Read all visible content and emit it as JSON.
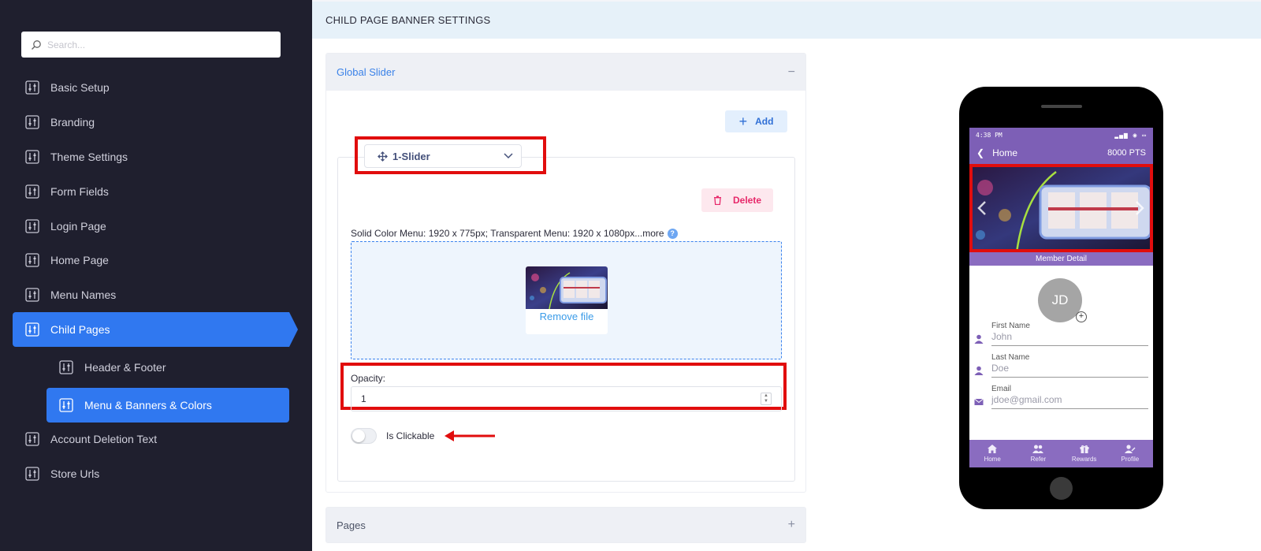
{
  "sidebar": {
    "search_placeholder": "Search...",
    "items": [
      {
        "label": "Basic Setup"
      },
      {
        "label": "Branding"
      },
      {
        "label": "Theme Settings"
      },
      {
        "label": "Form Fields"
      },
      {
        "label": "Login Page"
      },
      {
        "label": "Home Page"
      },
      {
        "label": "Menu Names"
      },
      {
        "label": "Child Pages"
      },
      {
        "label": "Header & Footer"
      },
      {
        "label": "Menu & Banners & Colors"
      },
      {
        "label": "Account Deletion Text"
      },
      {
        "label": "Store Urls"
      }
    ],
    "active_item": "Child Pages",
    "active_subitem": "Menu & Banners & Colors"
  },
  "main": {
    "page_title": "CHILD PAGE BANNER SETTINGS",
    "global_slider": {
      "title": "Global Slider",
      "collapse_symbol": "−",
      "add_label": "Add",
      "slider_name": "1-Slider",
      "delete_label": "Delete",
      "size_note": "Solid Color Menu: 1920 x 775px; Transparent Menu: 1920 x 1080px...more",
      "help_symbol": "?",
      "remove_file_label": "Remove file",
      "opacity_label": "Opacity:",
      "opacity_value": "1",
      "clickable_label": "Is Clickable",
      "clickable_on": false
    },
    "pages_panel": {
      "title": "Pages",
      "expand_symbol": "+"
    }
  },
  "phone": {
    "status_time": "4:38 PM",
    "header_title": "Home",
    "points": "8000 PTS",
    "member_detail": "Member Detail",
    "avatar_initials": "JD",
    "fields": [
      {
        "label": "First Name",
        "value": "John"
      },
      {
        "label": "Last Name",
        "value": "Doe"
      },
      {
        "label": "Email",
        "value": "jdoe@gmail.com"
      }
    ],
    "tabs": [
      "Home",
      "Refer",
      "Rewards",
      "Profile"
    ]
  },
  "colors": {
    "sidebar_bg": "#1f1f2e",
    "accent": "#3078f0",
    "annotation_red": "#e10d0d",
    "phone_purple": "#7d5fb6"
  }
}
